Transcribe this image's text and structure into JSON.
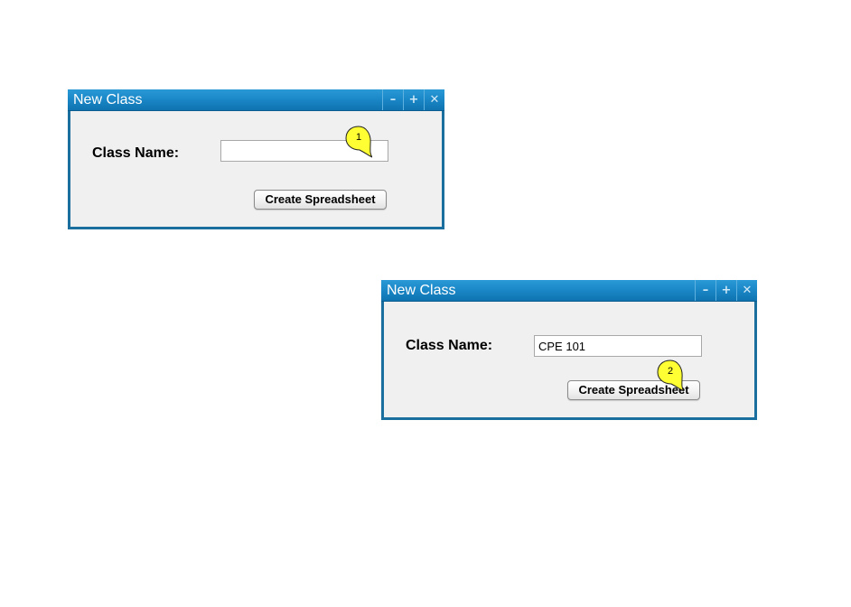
{
  "windows": [
    {
      "title": "New Class",
      "controls": {
        "minimize": "–",
        "maximize": "+",
        "close": "✕"
      },
      "class_name_label": "Class Name:",
      "class_name_value": "",
      "create_button_label": "Create Spreadsheet",
      "callout_number": "1"
    },
    {
      "title": "New Class",
      "controls": {
        "minimize": "–",
        "maximize": "+",
        "close": "✕"
      },
      "class_name_label": "Class Name:",
      "class_name_value": "CPE 101",
      "create_button_label": "Create Spreadsheet",
      "callout_number": "2"
    }
  ],
  "colors": {
    "titlebar": "#1a86c6",
    "window_border": "#1b6f9e",
    "window_body": "#f0f0f0",
    "callout_fill": "#ffff33"
  },
  "icons": [
    "minimize-icon",
    "maximize-icon",
    "close-icon",
    "callout-marker"
  ]
}
